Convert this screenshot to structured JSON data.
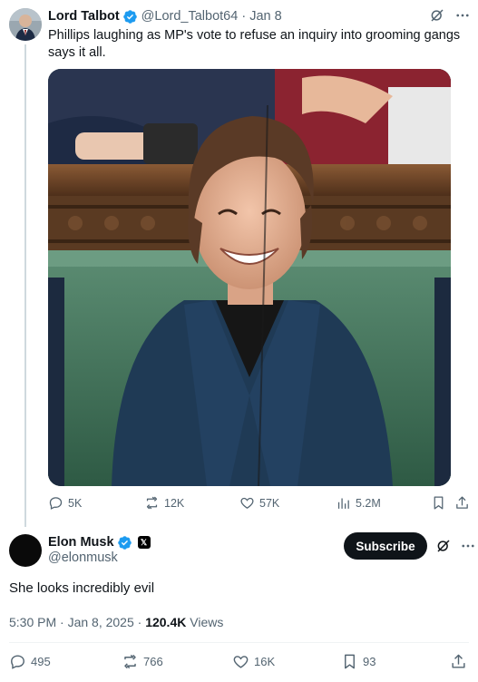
{
  "parent_tweet": {
    "name": "Lord Talbot",
    "handle": "@Lord_Talbot64",
    "date": "Jan 8",
    "text": "Phillips laughing as MP's vote to refuse an inquiry into grooming gangs says it all.",
    "stats": {
      "replies": "5K",
      "reposts": "12K",
      "likes": "57K",
      "views": "5.2M"
    }
  },
  "main_tweet": {
    "name": "Elon Musk",
    "handle": "@elonmusk",
    "subscribe_label": "Subscribe",
    "text": "She looks incredibly evil",
    "timestamp": "5:30 PM · Jan 8, 2025 · ",
    "views_count": "120.4K",
    "views_label": " Views",
    "stats": {
      "replies": "495",
      "reposts": "766",
      "likes": "16K",
      "bookmarks": "93"
    }
  },
  "colors": {
    "verified_blue": "#1d9bf0",
    "muted_text": "#536471",
    "primary_text": "#0f1419",
    "divider": "#eff3f4"
  },
  "icons": [
    "grok-icon",
    "more-icon",
    "reply-icon",
    "repost-icon",
    "like-icon",
    "views-icon",
    "bookmark-icon",
    "share-icon",
    "verified-badge-icon",
    "x-affiliate-badge"
  ]
}
